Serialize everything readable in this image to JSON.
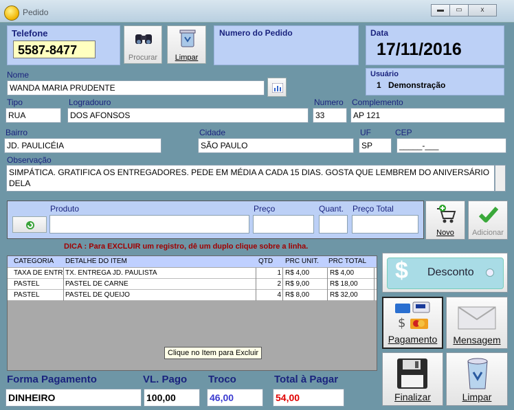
{
  "window": {
    "title": "Pedido",
    "min": "▬",
    "max": "▭",
    "close": "x"
  },
  "telefone": {
    "label": "Telefone",
    "value": "5587-8477"
  },
  "buttons": {
    "procurar": "Procurar",
    "limpar_top": "Limpar",
    "novo": "Novo",
    "adicionar": "Adicionar",
    "desconto": "Desconto",
    "pagamento": "Pagamento",
    "mensagem": "Mensagem",
    "finalizar": "Finalizar",
    "limpar_bottom": "Limpar"
  },
  "pedido": {
    "label": "Numero do Pedido",
    "value": ""
  },
  "data": {
    "label": "Data",
    "value": "17/11/2016"
  },
  "usuario": {
    "label": "Usuário",
    "id": "1",
    "name": "Demonstração"
  },
  "cliente": {
    "nome_label": "Nome",
    "nome": "WANDA MARIA PRUDENTE",
    "tipo_label": "Tipo",
    "tipo": "RUA",
    "logradouro_label": "Logradouro",
    "logradouro": "DOS AFONSOS",
    "numero_label": "Numero",
    "numero": "33",
    "complemento_label": "Complemento",
    "complemento": "AP 121",
    "bairro_label": "Bairro",
    "bairro": "JD. PAULICÉIA",
    "cidade_label": "Cidade",
    "cidade": "SÃO PAULO",
    "uf_label": "UF",
    "uf": "SP",
    "cep_label": "CEP",
    "cep": "_____-___",
    "obs_label": "Observação",
    "obs": "SIMPÁTICA. GRATIFICA OS ENTREGADORES. PEDE EM MÉDIA A CADA 15 DIAS. GOSTA QUE LEMBREM DO ANIVERSÁRIO DELA"
  },
  "item_entry": {
    "produto_label": "Produto",
    "preco_label": "Preço",
    "quant_label": "Quant.",
    "total_label": "Preço Total"
  },
  "dica": "DICA : Para EXCLUIR um registro, dê um duplo clique sobre a linha.",
  "grid": {
    "headers": [
      "CATEGORIA",
      "DETALHE DO ITEM",
      "QTD",
      "PRC UNIT.",
      "PRC TOTAL"
    ],
    "rows": [
      [
        "TAXA DE ENTREGA",
        "TX. ENTREGA JD. PAULISTA",
        "1",
        "R$ 4,00",
        "R$ 4,00"
      ],
      [
        "PASTEL",
        "PASTEL DE CARNE",
        "2",
        "R$ 9,00",
        "R$ 18,00"
      ],
      [
        "PASTEL",
        "PASTEL DE QUEIJO",
        "4",
        "R$ 8,00",
        "R$ 32,00"
      ]
    ]
  },
  "tooltip": "Clique no Item para Excluir",
  "totais": {
    "forma_label": "Forma Pagamento",
    "forma": "DINHEIRO",
    "vlpago_label": "VL. Pago",
    "vlpago": "100,00",
    "troco_label": "Troco",
    "troco": "46,00",
    "total_label": "Total à Pagar",
    "total": "54,00"
  },
  "colors": {
    "troco": "#3a3ad0",
    "total": "#e00000",
    "panel": "#bcd0f6"
  }
}
